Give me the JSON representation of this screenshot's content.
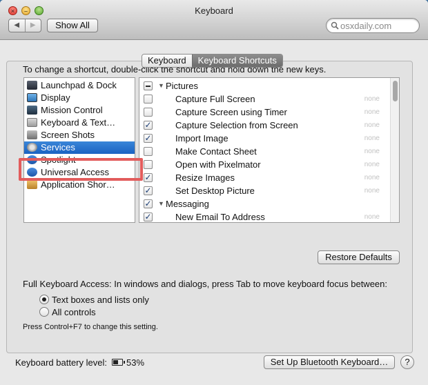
{
  "window": {
    "title": "Keyboard"
  },
  "toolbar": {
    "back_label": "◀",
    "forward_label": "▶",
    "show_all_label": "Show All"
  },
  "search": {
    "value": "osxdaily.com"
  },
  "tabs": [
    {
      "label": "Keyboard"
    },
    {
      "label": "Keyboard Shortcuts"
    }
  ],
  "instructions": "To change a shortcut, double-click the shortcut and hold down the new keys.",
  "categories": [
    {
      "label": "Launchpad & Dock",
      "icon": "launchpad-icon"
    },
    {
      "label": "Display",
      "icon": "display-icon"
    },
    {
      "label": "Mission Control",
      "icon": "mission-control-icon"
    },
    {
      "label": "Keyboard & Text…",
      "icon": "keyboard-icon"
    },
    {
      "label": "Screen Shots",
      "icon": "screenshot-icon"
    },
    {
      "label": "Services",
      "icon": "gear-icon"
    },
    {
      "label": "Spotlight",
      "icon": "spotlight-icon"
    },
    {
      "label": "Universal Access",
      "icon": "universal-access-icon"
    },
    {
      "label": "Application Shor…",
      "icon": "app-shortcuts-icon"
    }
  ],
  "shortcuts": [
    {
      "type": "group",
      "label": "Pictures",
      "state": "mixed"
    },
    {
      "type": "item",
      "label": "Capture Full Screen",
      "checked": false,
      "shortcut": "none"
    },
    {
      "type": "item",
      "label": "Capture Screen using Timer",
      "checked": false,
      "shortcut": "none"
    },
    {
      "type": "item",
      "label": "Capture Selection from Screen",
      "checked": true,
      "shortcut": "none"
    },
    {
      "type": "item",
      "label": "Import Image",
      "checked": true,
      "shortcut": "none"
    },
    {
      "type": "item",
      "label": "Make Contact Sheet",
      "checked": false,
      "shortcut": "none"
    },
    {
      "type": "item",
      "label": "Open with Pixelmator",
      "checked": false,
      "shortcut": "none"
    },
    {
      "type": "item",
      "label": "Resize Images",
      "checked": true,
      "shortcut": "none"
    },
    {
      "type": "item",
      "label": "Set Desktop Picture",
      "checked": true,
      "shortcut": "none"
    },
    {
      "type": "group",
      "label": "Messaging",
      "state": "checked"
    },
    {
      "type": "item",
      "label": "New Email To Address",
      "checked": true,
      "shortcut": "none"
    }
  ],
  "restore_defaults_label": "Restore Defaults",
  "full_keyboard_access": {
    "label": "Full Keyboard Access: In windows and dialogs, press Tab to move keyboard focus between:",
    "options": [
      {
        "label": "Text boxes and lists only",
        "selected": true
      },
      {
        "label": "All controls",
        "selected": false
      }
    ],
    "hint": "Press Control+F7 to change this setting."
  },
  "battery": {
    "label": "Keyboard battery level:",
    "percent_text": "53%"
  },
  "bluetooth_button_label": "Set Up Bluetooth Keyboard…",
  "help_label": "?",
  "colors": {
    "selection": "#2a73cd",
    "highlight_box": "#e25c5c"
  }
}
